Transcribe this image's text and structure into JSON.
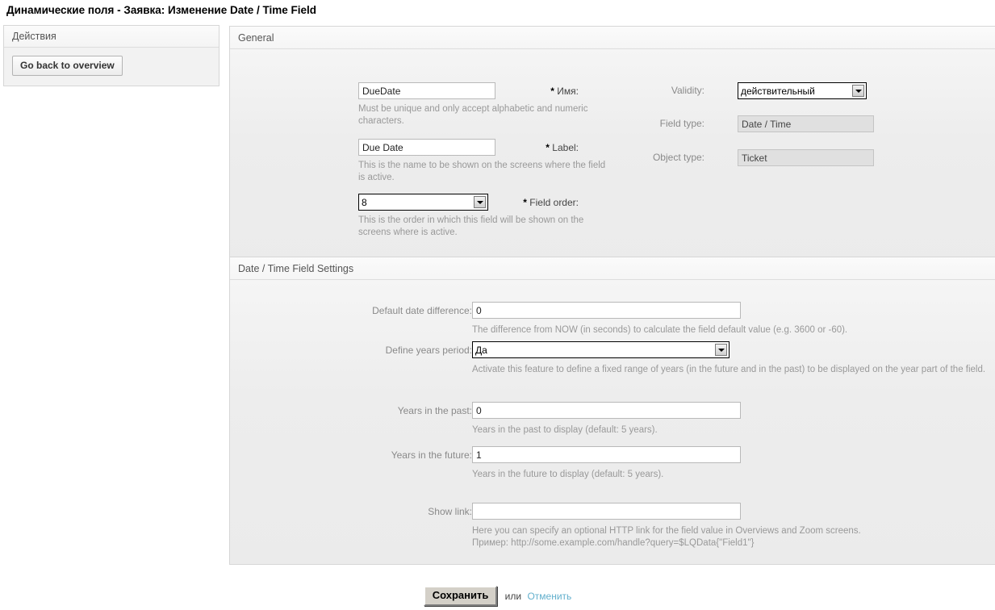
{
  "page": {
    "title": "Динамические поля - Заявка: Изменение Date / Time Field"
  },
  "sidebar": {
    "header": "Действия",
    "back_button": "Go back to overview"
  },
  "general": {
    "header": "General",
    "name": {
      "label": "Имя:",
      "value": "DueDate",
      "help": "Must be unique and only accept alphabetic and numeric characters."
    },
    "label_field": {
      "label": "Label:",
      "value": "Due Date",
      "help": "This is the name to be shown on the screens where the field is active."
    },
    "field_order": {
      "label": "Field order:",
      "value": "8",
      "help": "This is the order in which this field will be shown on the screens where is active."
    },
    "validity": {
      "label": "Validity:",
      "value": "действительный"
    },
    "field_type": {
      "label": "Field type:",
      "value": "Date / Time"
    },
    "object_type": {
      "label": "Object type:",
      "value": "Ticket"
    }
  },
  "settings": {
    "header": "Date / Time Field Settings",
    "default_date_difference": {
      "label": "Default date difference:",
      "value": "0",
      "help": "The difference from NOW (in seconds) to calculate the field default value (e.g. 3600 or -60)."
    },
    "define_years_period": {
      "label": "Define years period:",
      "value": "Да",
      "help": "Activate this feature to define a fixed range of years (in the future and in the past) to be displayed on the year part of the field."
    },
    "years_in_past": {
      "label": "Years in the past:",
      "value": "0",
      "help": "Years in the past to display (default: 5 years)."
    },
    "years_in_future": {
      "label": "Years in the future:",
      "value": "1",
      "help": "Years in the future to display (default: 5 years)."
    },
    "show_link": {
      "label": "Show link:",
      "value": "",
      "placeholder": "",
      "help_line1": "Here you can specify an optional HTTP link for the field value in Overviews and Zoom screens.",
      "help_line2": "Пример: http://some.example.com/handle?query=$LQData{\"Field1\"}"
    }
  },
  "footer": {
    "save_label": "Сохранить",
    "or_label": "или",
    "cancel_label": "Отменить"
  },
  "colors": {
    "link": "#63b0cd",
    "panel_bg": "#ebebeb",
    "readonly_bg": "#e0e0e0"
  }
}
